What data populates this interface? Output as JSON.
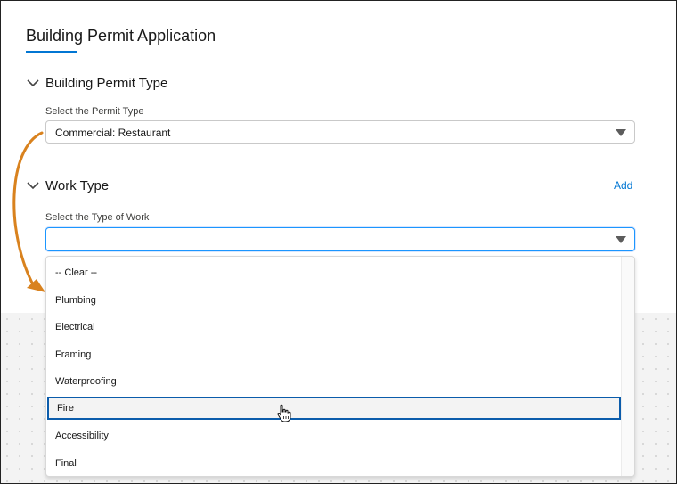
{
  "page": {
    "title": "Building Permit Application"
  },
  "sections": [
    {
      "title": "Building Permit Type",
      "field_label": "Select the Permit Type",
      "value": "Commercial: Restaurant"
    },
    {
      "title": "Work Type",
      "add_label": "Add",
      "field_label": "Select the Type of Work",
      "value": ""
    }
  ],
  "dropdown": {
    "options": [
      "-- Clear --",
      "Plumbing",
      "Electrical",
      "Framing",
      "Waterproofing",
      "Fire",
      "Accessibility",
      "Final"
    ],
    "highlighted": "Fire"
  },
  "colors": {
    "accent": "#0176d3",
    "focus_border": "#1b96ff",
    "highlight_border": "#0b5cab",
    "annotation_arrow": "#d9821e"
  },
  "icons": [
    "chevron-down-icon",
    "dropdown-caret-icon",
    "hand-pointer-cursor-icon",
    "annotation-arrow"
  ]
}
